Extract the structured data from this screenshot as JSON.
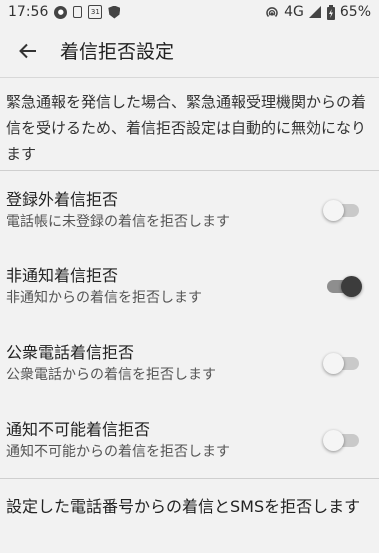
{
  "status_bar": {
    "time": "17:56",
    "calendar_day": "31",
    "network": "4G",
    "battery": "65%",
    "icons": [
      "notification-badge-icon",
      "sim-card-icon",
      "calendar-icon",
      "shield-icon",
      "hotspot-icon",
      "signal-icon",
      "battery-charging-icon"
    ]
  },
  "app_bar": {
    "back_icon": "arrow-left-icon",
    "title": "着信拒否設定"
  },
  "notice": "緊急通報を発信した場合、緊急通報受理機関からの着信を受けるため、着信拒否設定は自動的に無効になります",
  "settings": [
    {
      "title": "登録外着信拒否",
      "subtitle": "電話帳に未登録の着信を拒否します",
      "enabled": false
    },
    {
      "title": "非通知着信拒否",
      "subtitle": "非通知からの着信を拒否します",
      "enabled": true
    },
    {
      "title": "公衆電話着信拒否",
      "subtitle": "公衆電話からの着信を拒否します",
      "enabled": false
    },
    {
      "title": "通知不可能着信拒否",
      "subtitle": "通知不可能からの着信を拒否します",
      "enabled": false
    }
  ],
  "bottom_item": "設定した電話番号からの着信とSMSを拒否します"
}
